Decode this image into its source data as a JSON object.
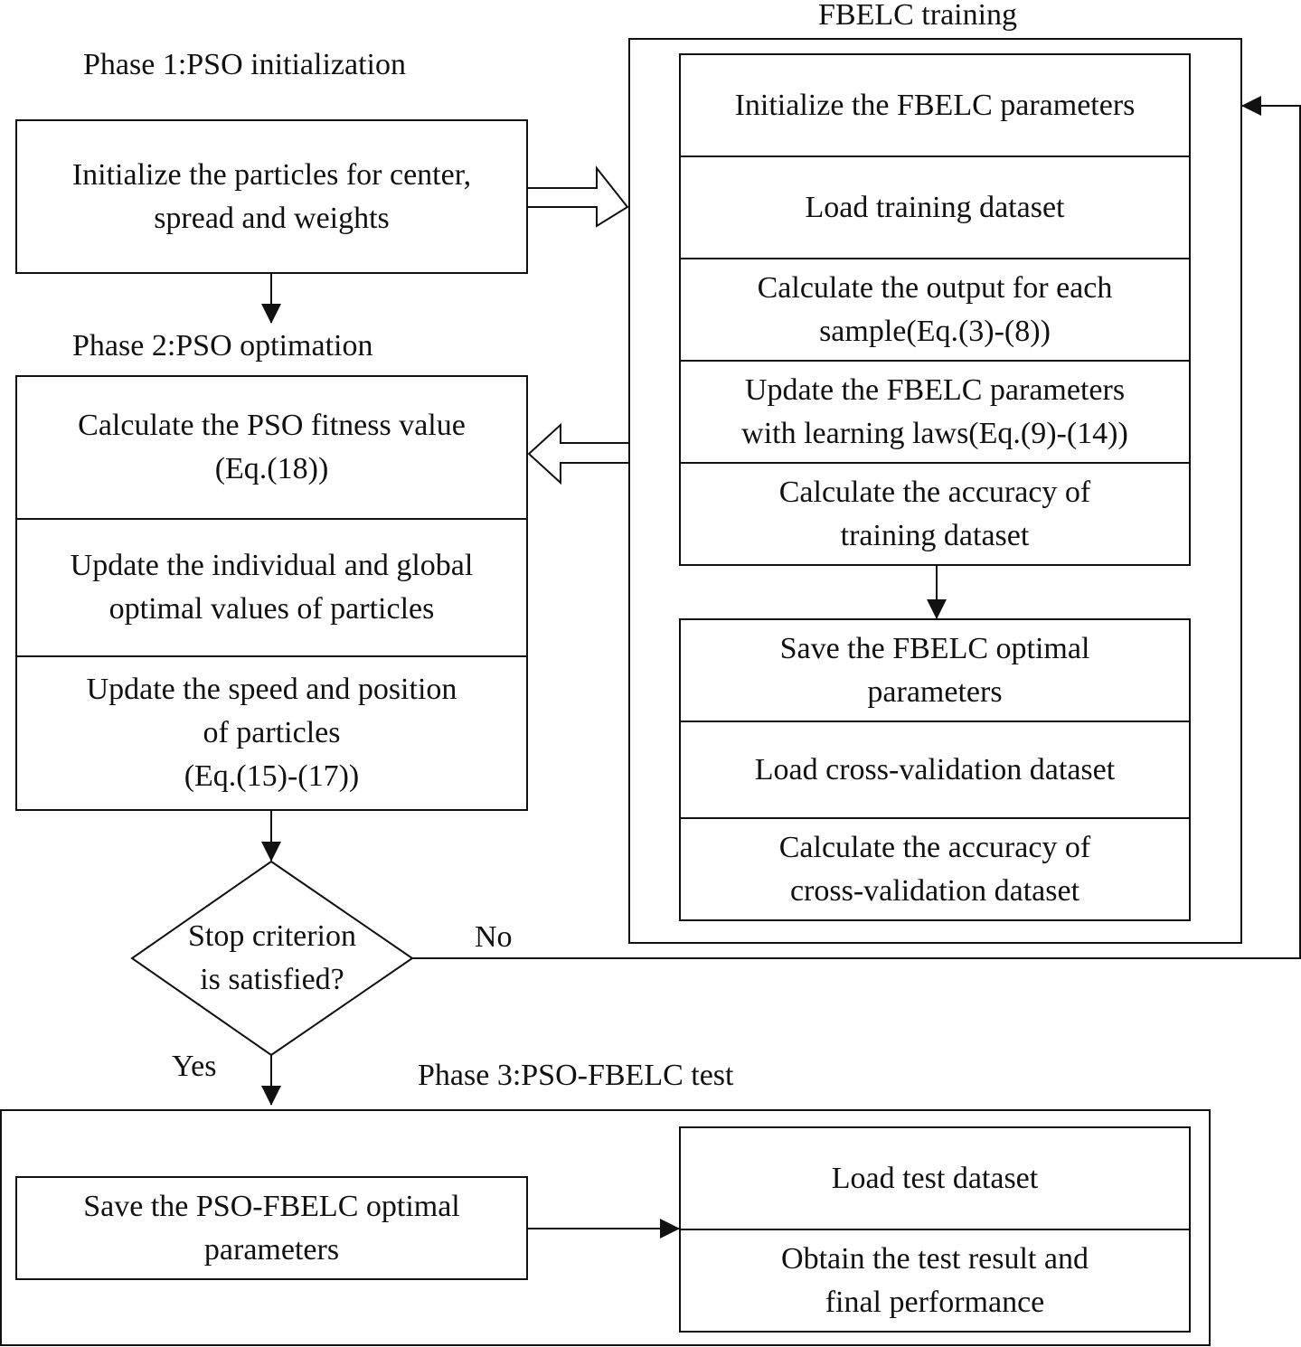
{
  "phase1": {
    "title": "Phase 1:PSO initialization",
    "steps": [
      "Initialize the particles for center,\nspread and weights"
    ]
  },
  "phase2": {
    "title": "Phase 2:PSO optimation",
    "steps": [
      "Calculate the PSO fitness value\n(Eq.(18))",
      "Update the individual and global\noptimal values of particles",
      "Update the speed and position\nof particles\n(Eq.(15)-(17))"
    ]
  },
  "training": {
    "title": "FBELC training",
    "steps": [
      "Initialize the FBELC parameters",
      "Load training dataset",
      "Calculate the output for each\nsample(Eq.(3)-(8))",
      "Update the FBELC parameters\nwith learning laws(Eq.(9)-(14))",
      "Calculate the accuracy of\ntraining dataset"
    ],
    "validation_steps": [
      "Save the FBELC optimal\nparameters",
      "Load cross-validation dataset",
      "Calculate the accuracy of\ncross-validation dataset"
    ]
  },
  "decision": {
    "text": "Stop criterion\nis satisfied?",
    "no": "No",
    "yes": "Yes"
  },
  "phase3": {
    "title": "Phase 3:PSO-FBELC test",
    "save": "Save the PSO-FBELC optimal\nparameters",
    "steps": [
      "Load test dataset",
      "Obtain the test result and\nfinal performance"
    ]
  }
}
